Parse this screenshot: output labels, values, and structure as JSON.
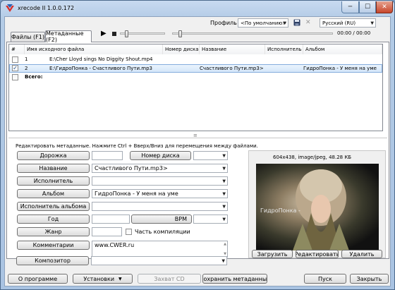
{
  "window": {
    "title": "xrecode II 1.0.0.172",
    "minimize_glyph": "─",
    "maximize_glyph": "☐",
    "close_glyph": "✕"
  },
  "toolbar": {
    "profile_label": "Профиль",
    "profile_value": "<По умолчанию>",
    "language_value": "Русский (RU)",
    "time_display": "00:00 / 00:00"
  },
  "tabs": [
    {
      "label": "Файлы (F1)"
    },
    {
      "label": "Метаданные (F2)"
    }
  ],
  "file_list": {
    "columns": [
      "#",
      "Имя исходного файла",
      "Номер диска",
      "Название",
      "Исполнитель",
      "Альбом"
    ],
    "rows": [
      {
        "checked": false,
        "num": "1",
        "filename": "E:\\Cher Lloyd sings No Diggity  Shout.mp4",
        "disc": "",
        "title": "",
        "artist": "",
        "album": ""
      },
      {
        "checked": true,
        "num": "2",
        "filename": "E:\\ГидроПонка - Счастливого Пути.mp3",
        "disc": "",
        "title": "Счастливого Пути.mp3>",
        "artist": "",
        "album": "ГидроПонка - У меня на уме"
      }
    ],
    "total_label": "Всего:",
    "splitter_glyph": "≡"
  },
  "editor": {
    "hint": "Редактировать метаданные. Нажмите Ctrl + Вверх/Вниз для перемещения между файлами.",
    "fields": {
      "track_label": "Дорожка",
      "disc_label": "Номер диска",
      "title_label": "Название",
      "title_value": "Счастливого Пути.mp3>",
      "artist_label": "Исполнитель",
      "artist_value": "",
      "album_label": "Альбом",
      "album_value": "ГидроПонка - У меня на уме",
      "album_artist_label": "Исполнитель альбома",
      "album_artist_value": "",
      "year_label": "Год",
      "bpm_label": "BPM",
      "genre_label": "Жанр",
      "compilation_label": "Часть компиляции",
      "comment_label": "Комментарии",
      "comment_value": "www.CWER.ru",
      "composer_label": "Композитор",
      "composer_value": ""
    }
  },
  "artwork": {
    "info": "604x438, image/jpeg, 48.28 КБ",
    "photo_caption": "ГидроПонка -",
    "load_button": "Загрузить",
    "edit_button": "Редактировать",
    "delete_button": "Удалить"
  },
  "bottom_bar": {
    "about_button": "О программе",
    "settings_button": "Установки",
    "grab_cd_button": "Захват CD",
    "save_metadata_button": "Сохранить метаданные",
    "start_button": "Пуск",
    "close_button": "Закрыть"
  },
  "colors": {
    "title_bar": "#b3cbe6",
    "selection": "#d4e6f9",
    "close_button": "#c7452a"
  }
}
